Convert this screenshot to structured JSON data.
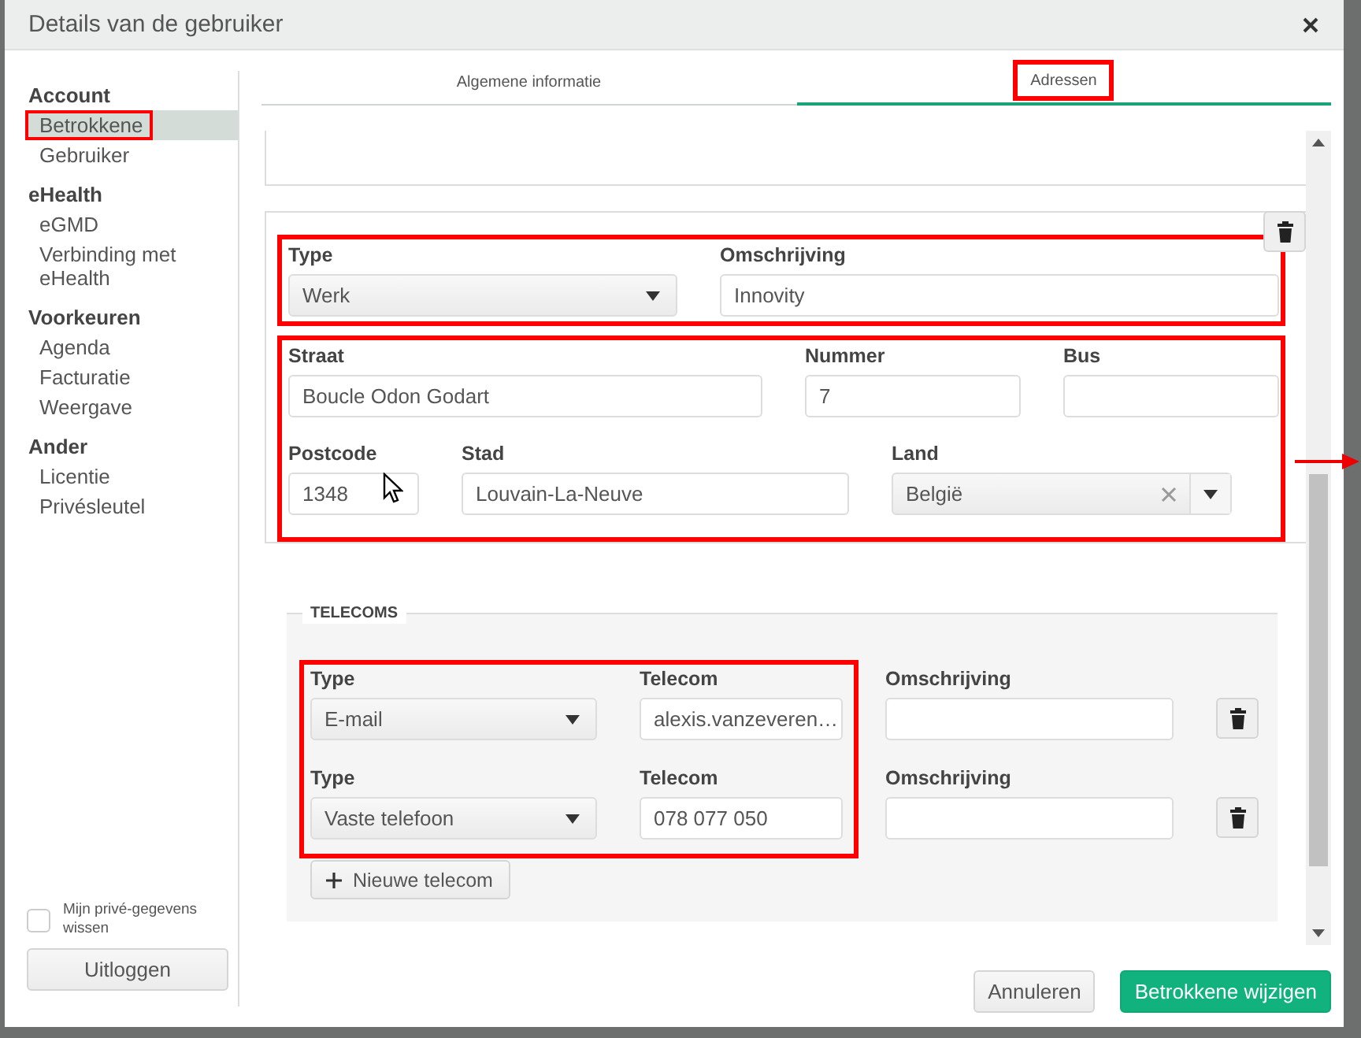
{
  "window": {
    "title": "Details van de gebruiker"
  },
  "sidebar": {
    "groups": [
      {
        "heading": "Account",
        "items": [
          {
            "label": "Betrokkene",
            "selected": true,
            "highlighted": true
          },
          {
            "label": "Gebruiker",
            "selected": false,
            "highlighted": false
          }
        ]
      },
      {
        "heading": "eHealth",
        "items": [
          {
            "label": "eGMD",
            "selected": false,
            "highlighted": false
          },
          {
            "label": "Verbinding met eHealth",
            "selected": false,
            "highlighted": false
          }
        ]
      },
      {
        "heading": "Voorkeuren",
        "items": [
          {
            "label": "Agenda",
            "selected": false,
            "highlighted": false
          },
          {
            "label": "Facturatie",
            "selected": false,
            "highlighted": false
          },
          {
            "label": "Weergave",
            "selected": false,
            "highlighted": false
          }
        ]
      },
      {
        "heading": "Ander",
        "items": [
          {
            "label": "Licentie",
            "selected": false,
            "highlighted": false
          },
          {
            "label": "Privésleutel",
            "selected": false,
            "highlighted": false
          }
        ]
      }
    ],
    "clear_private_data": {
      "label": "Mijn privé-gegevens wissen",
      "checked": false
    },
    "logout_button": "Uitloggen"
  },
  "tabs": [
    {
      "label": "Algemene informatie",
      "selected": false,
      "highlighted": false
    },
    {
      "label": "Adressen",
      "selected": true,
      "highlighted": true
    }
  ],
  "address": {
    "sections": [
      {
        "highlighted": true,
        "rows": [
          [
            {
              "kind": "select",
              "label": "Type",
              "value": "Werk"
            },
            {
              "kind": "text",
              "label": "Omschrijving",
              "value": "Innovity"
            }
          ]
        ]
      },
      {
        "highlighted": true,
        "rows": [
          [
            {
              "kind": "text",
              "label": "Straat",
              "value": "Boucle Odon Godart"
            },
            {
              "kind": "text",
              "label": "Nummer",
              "value": "7"
            },
            {
              "kind": "text",
              "label": "Bus"
            }
          ],
          [
            {
              "kind": "text",
              "label": "Postcode",
              "value": "1348"
            },
            {
              "kind": "text",
              "label": "Stad",
              "value": "Louvain-La-Neuve"
            },
            {
              "kind": "combo",
              "label": "Land",
              "value": "België"
            }
          ]
        ]
      }
    ]
  },
  "telecoms": {
    "title": "TELECOMS",
    "highlighted": true,
    "rows": [
      {
        "type_label": "Type",
        "type": "E-mail",
        "telecom_label": "Telecom",
        "telecom": "alexis.vanzeveren…",
        "description_label": "Omschrijving"
      },
      {
        "type_label": "Type",
        "type": "Vaste telefoon",
        "telecom_label": "Telecom",
        "telecom": "078 077 050",
        "description_label": "Omschrijving"
      }
    ],
    "add_button": "Nieuwe telecom"
  },
  "footer": {
    "buttons": [
      {
        "label": "Annuleren",
        "kind": "secondary"
      },
      {
        "label": "Betrokkene wijzigen",
        "kind": "primary"
      }
    ]
  }
}
